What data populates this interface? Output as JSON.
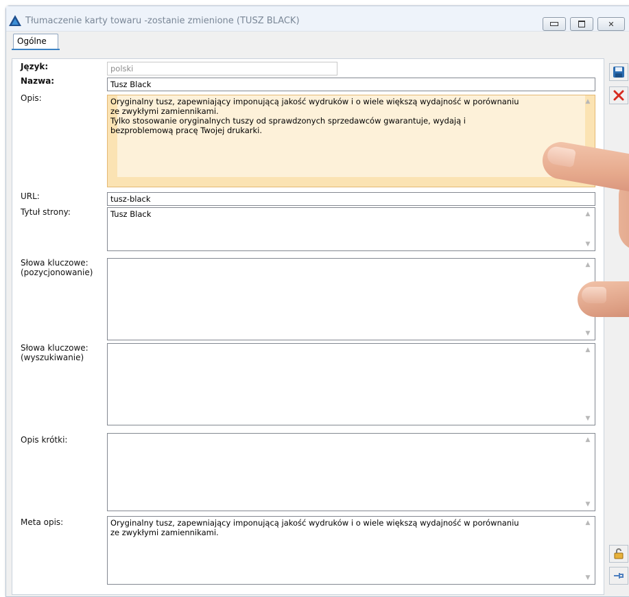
{
  "window": {
    "title": "Tłumaczenie karty towaru -zostanie zmienione (TUSZ BLACK)",
    "accent_color": "#1e4f8f"
  },
  "tabs": [
    {
      "label": "Ogólne",
      "active": true
    }
  ],
  "form": {
    "jezyk": {
      "label": "Język:",
      "value": "polski"
    },
    "nazwa": {
      "label": "Nazwa:",
      "value": "Tusz Black"
    },
    "opis": {
      "label": "Opis:",
      "value": "Oryginalny tusz, zapewniający imponującą jakość wydruków i o wiele większą wydajność w porównaniu\nze zwykłymi zamiennikami.\nTylko stosowanie oryginalnych tuszy od sprawdzonych sprzedawców gwarantuje, wydają i\nbezproblemową pracę Twojej drukarki."
    },
    "url": {
      "label": "URL:",
      "value": "tusz-black"
    },
    "tytul": {
      "label": "Tytuł strony:",
      "value": "Tusz Black"
    },
    "slowa_poz": {
      "label": "Słowa kluczowe:\n(pozycjonowanie)",
      "value": ""
    },
    "slowa_wysz": {
      "label": "Słowa kluczowe:\n(wyszukiwanie)",
      "value": ""
    },
    "opis_krotki": {
      "label": "Opis krótki:",
      "value": ""
    },
    "meta_opis": {
      "label": "Meta opis:",
      "value": "Oryginalny tusz, zapewniający imponującą jakość wydruków i o wiele większą wydajność w porównaniu\nze zwykłymi zamiennikami."
    }
  },
  "toolbar": {
    "save_icon": "floppy-disk-icon",
    "cancel_icon": "red-x-icon",
    "lock_icon": "padlock-icon",
    "pin_icon": "pin-icon"
  }
}
